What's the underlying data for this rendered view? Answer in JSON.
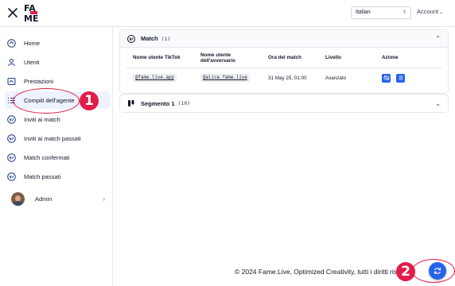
{
  "header": {
    "logo_top": "FA",
    "logo_bottom": "ME",
    "language": "Italian",
    "account_label": "Account"
  },
  "sidebar": {
    "items": [
      {
        "label": "Home",
        "icon": "home-icon"
      },
      {
        "label": "Utenti",
        "icon": "user-icon"
      },
      {
        "label": "Prestazioni",
        "icon": "performance-icon"
      },
      {
        "label": "Compiti dell'agente",
        "icon": "list-icon"
      },
      {
        "label": "Inviti ai match",
        "icon": "versus-icon"
      },
      {
        "label": "Inviti ai match passati",
        "icon": "versus-icon"
      },
      {
        "label": "Match confermati",
        "icon": "versus-icon"
      },
      {
        "label": "Match passati",
        "icon": "versus-icon"
      }
    ],
    "admin_label": "Admin"
  },
  "match_card": {
    "title": "Match",
    "count": "(1)",
    "columns": [
      "Nome utente TikTok",
      "Nome utente dell'avversario",
      "Ora del match",
      "Livello",
      "Azione"
    ],
    "rows": [
      {
        "tiktok": "@fame.live.app",
        "opponent": "@alice.fame.live",
        "time": "31 May 25, 01:00",
        "level": "Avanzato"
      }
    ]
  },
  "segment_card": {
    "title": "Segmento 1",
    "count": "(10)"
  },
  "footer": {
    "text": "© 2024 Fame.Live, Optimized Creativity, tutti i diritti riservati"
  },
  "annotations": {
    "one": "1",
    "two": "2",
    "color": "#e11d48"
  },
  "colors": {
    "accent": "#2563eb",
    "active_bg": "#eef2ff"
  }
}
